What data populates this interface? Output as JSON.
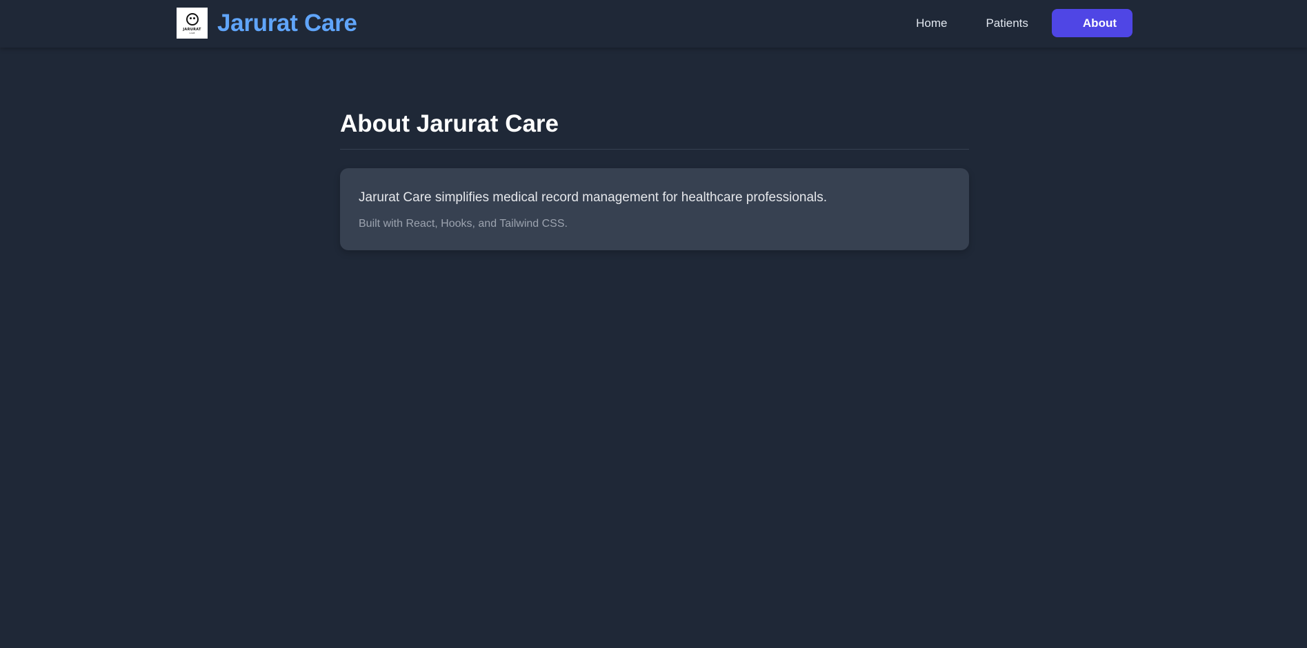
{
  "header": {
    "logo_text": "JARURAT",
    "logo_subtext": "CARE",
    "brand_name": "Jarurat Care",
    "nav": [
      {
        "label": "Home"
      },
      {
        "label": "Patients"
      },
      {
        "label": "About",
        "active": true
      }
    ]
  },
  "main": {
    "title": "About Jarurat Care",
    "card": {
      "description": "Jarurat Care simplifies medical record management for healthcare professionals.",
      "note": "Built with React, Hooks, and Tailwind CSS."
    }
  },
  "colors": {
    "background": "#1f2837",
    "brand": "#60a5fa",
    "accent": "#4f46e5",
    "card": "#374151"
  }
}
